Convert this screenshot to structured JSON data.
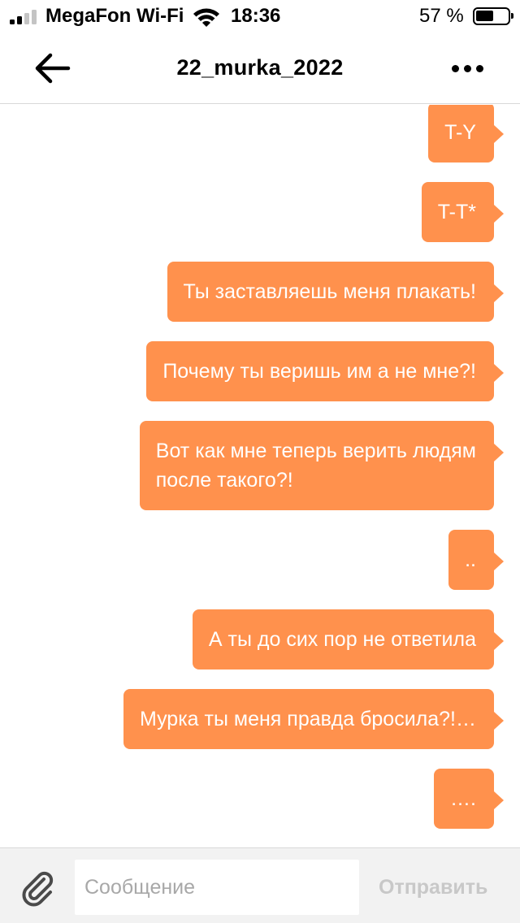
{
  "status_bar": {
    "carrier": "MegaFon Wi-Fi",
    "time": "18:36",
    "battery_percent_text": "57 %",
    "battery_level": 0.57,
    "signal_bars_active": 2,
    "signal_bars_total": 4
  },
  "header": {
    "title": "22_murka_2022",
    "back_icon": "arrow-left-icon",
    "more_icon": "more-dots-icon"
  },
  "messages": [
    {
      "text": "T-Y",
      "from": "me"
    },
    {
      "text": "T-T*",
      "from": "me"
    },
    {
      "text": "Ты заставляешь меня плакать!",
      "from": "me"
    },
    {
      "text": "Почему ты веришь им а не мне?!",
      "from": "me"
    },
    {
      "text": "Вот как мне теперь верить людям\nпосле такого?!",
      "from": "me"
    },
    {
      "text": "..",
      "from": "me"
    },
    {
      "text": "А ты до сих пор не ответила",
      "from": "me"
    },
    {
      "text": "Мурка ты меня правда бросила?!…",
      "from": "me"
    },
    {
      "text": "….",
      "from": "me"
    }
  ],
  "composer": {
    "placeholder": "Сообщение",
    "value": "",
    "send_label": "Отправить",
    "attach_icon": "paperclip-icon"
  },
  "colors": {
    "bubble": "#FF914D",
    "bubble_text": "#FFFFFF",
    "send_disabled": "#C8C8C8",
    "input_bar_bg": "#F2F2F2"
  }
}
